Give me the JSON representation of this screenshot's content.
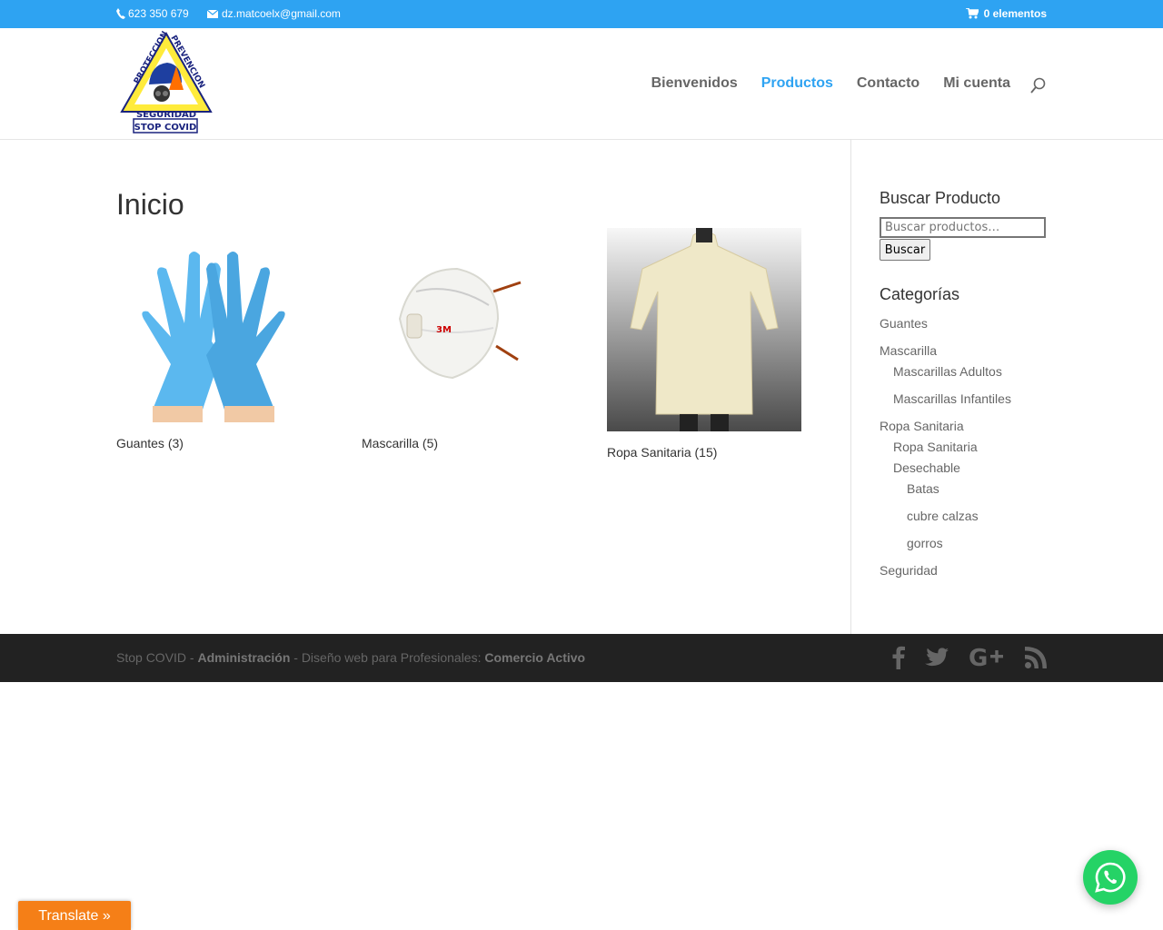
{
  "topbar": {
    "phone": "623 350 679",
    "email": "dz.matcoelx@gmail.com",
    "cart": "0 elementos",
    "color": "#2ea3f2"
  },
  "logo": {
    "top_text": "PROTECCION",
    "right_text": "PREVENCION",
    "bottom_text": "SEGURIDAD",
    "badge_text": "STOP COVID"
  },
  "nav": {
    "items": [
      {
        "label": "Bienvenidos",
        "active": false
      },
      {
        "label": "Productos",
        "active": true
      },
      {
        "label": "Contacto",
        "active": false
      },
      {
        "label": "Mi cuenta",
        "active": false
      }
    ]
  },
  "main": {
    "title": "Inicio",
    "products": [
      {
        "name": "Guantes",
        "count": "(3)"
      },
      {
        "name": "Mascarilla",
        "count": "(5)"
      },
      {
        "name": "Ropa Sanitaria",
        "count": "(15)"
      }
    ]
  },
  "sidebar": {
    "search_title": "Buscar Producto",
    "search_placeholder": "Buscar productos…",
    "search_button": "Buscar",
    "categories_title": "Categorías",
    "categories": [
      {
        "label": "Guantes",
        "level": 0
      },
      {
        "label": "Mascarilla",
        "level": 0
      },
      {
        "label": "Mascarillas Adultos",
        "level": 1
      },
      {
        "label": "Mascarillas Infantiles",
        "level": 1
      },
      {
        "label": "Ropa Sanitaria",
        "level": 0
      },
      {
        "label": "Ropa Sanitaria",
        "level": 1
      },
      {
        "label": "Desechable",
        "level": 1
      },
      {
        "label": "Batas",
        "level": 2
      },
      {
        "label": "cubre calzas",
        "level": 2
      },
      {
        "label": "gorros",
        "level": 2
      },
      {
        "label": "Seguridad",
        "level": 0
      }
    ]
  },
  "footer": {
    "prefix": "Stop COVID - ",
    "admin": "Administración",
    "middle": " - Diseño web para Profesionales: ",
    "company": "Comercio Activo",
    "social_icons": [
      "facebook-icon",
      "twitter-icon",
      "google-plus-icon",
      "rss-icon"
    ]
  },
  "translate": {
    "label": "Translate »"
  },
  "whatsapp": {
    "icon": "whatsapp-icon",
    "color": "#25d366"
  }
}
